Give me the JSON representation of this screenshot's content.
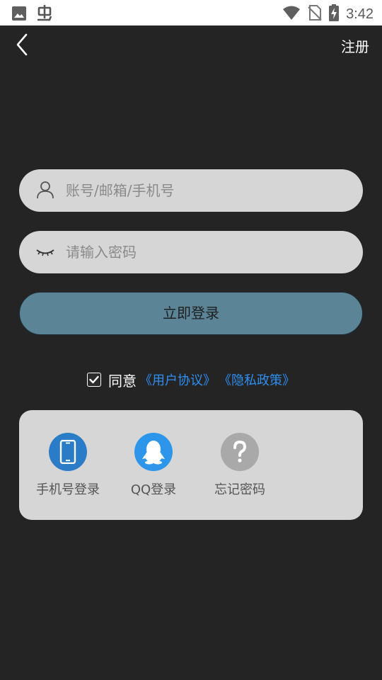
{
  "status_bar": {
    "time": "3:42",
    "left_icons": [
      "image-icon",
      "app-bug-icon"
    ],
    "right_icons": [
      "wifi-icon",
      "no-sim-icon",
      "battery-charging-icon"
    ]
  },
  "header": {
    "back_icon": "chevron-left-icon",
    "register_label": "注册"
  },
  "form": {
    "account_placeholder": "账号/邮箱/手机号",
    "account_value": "",
    "password_placeholder": "请输入密码",
    "password_value": "",
    "login_button": "立即登录"
  },
  "agreement": {
    "checked": true,
    "text": "同意",
    "user_agreement": "《用户协议》",
    "privacy_policy": "《隐私政策》"
  },
  "login_options": [
    {
      "label": "手机号登录",
      "icon": "phone-icon",
      "color": "#2a7cc7"
    },
    {
      "label": "QQ登录",
      "icon": "qq-penguin-icon",
      "color": "#2d95ea"
    },
    {
      "label": "忘记密码",
      "icon": "question-icon",
      "color": "#a9a9a9"
    }
  ],
  "colors": {
    "background": "#242424",
    "field": "#d6d6d6",
    "login_button": "#5b8596",
    "link": "#2f8ff3"
  }
}
